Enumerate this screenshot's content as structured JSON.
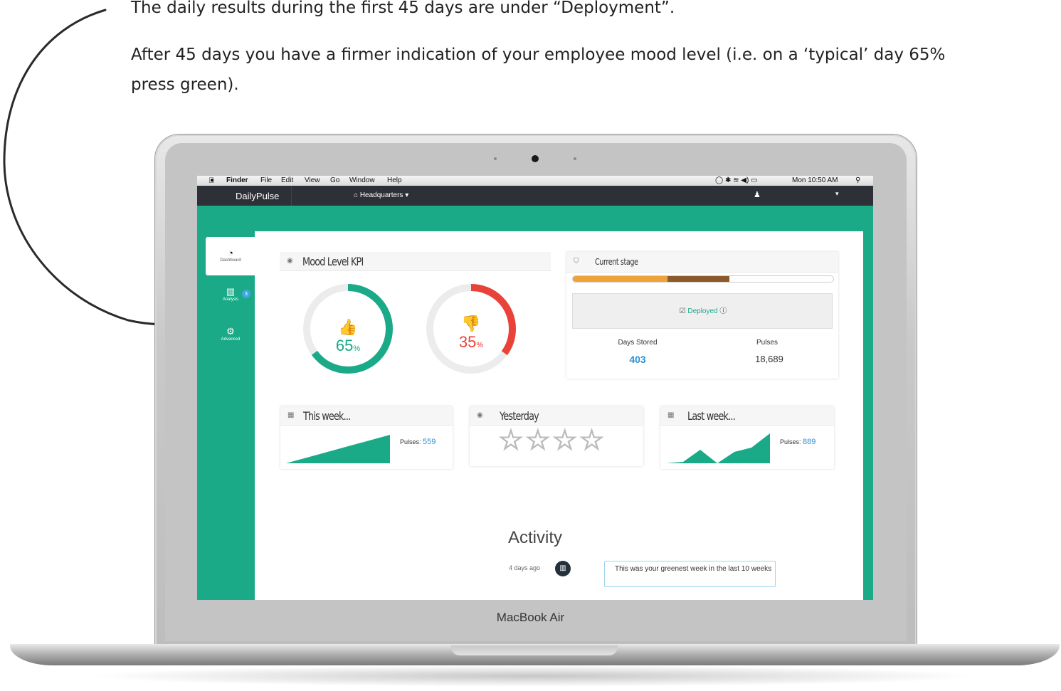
{
  "captions": {
    "line1": "The daily results during the first 45 days are under “Deployment”.",
    "line2": "After 45 days you have a firmer indication of your employee mood level (i.e. on a ‘typical’ day 65% press green)."
  },
  "device": {
    "brand": "MacBook Air"
  },
  "menubar": {
    "items": [
      "Finder",
      "File",
      "Edit",
      "View",
      "Go",
      "Window",
      "Help"
    ],
    "clock": "Mon 10:50 AM"
  },
  "app": {
    "name": "DailyPulse",
    "location": "Headquarters",
    "user_icon": "user-icon",
    "caret": "▾"
  },
  "sidebar": {
    "items": [
      {
        "label": "Dashboard",
        "icon": "gauge-icon"
      },
      {
        "label": "Analysis",
        "icon": "chart-icon",
        "badge": "3"
      },
      {
        "label": "Advanced",
        "icon": "gear-icon"
      }
    ]
  },
  "mood": {
    "title": "Mood Level KPI",
    "positive_pct": "65",
    "negative_pct": "35",
    "unit": "%",
    "positive_fraction": 0.65,
    "negative_fraction": 0.35,
    "colors": {
      "positive": "#1aaa87",
      "negative": "#e8423a",
      "track": "#ececec"
    }
  },
  "stage": {
    "title": "Current stage",
    "progress": 0.6,
    "status": "Deployed",
    "days_label": "Days Stored",
    "days_value": "403",
    "pulses_label": "Pulses",
    "pulses_value": "18,689"
  },
  "this_week": {
    "title": "This week...",
    "pulses_label": "Pulses:",
    "pulses_value": "559"
  },
  "yesterday": {
    "title": "Yesterday",
    "rating": 0,
    "max_rating": 5
  },
  "last_week": {
    "title": "Last week...",
    "pulses_label": "Pulses:",
    "pulses_value": "889"
  },
  "activity": {
    "title": "Activity",
    "time": "4 days ago",
    "message": "This was your greenest week in the last 10 weeks"
  }
}
